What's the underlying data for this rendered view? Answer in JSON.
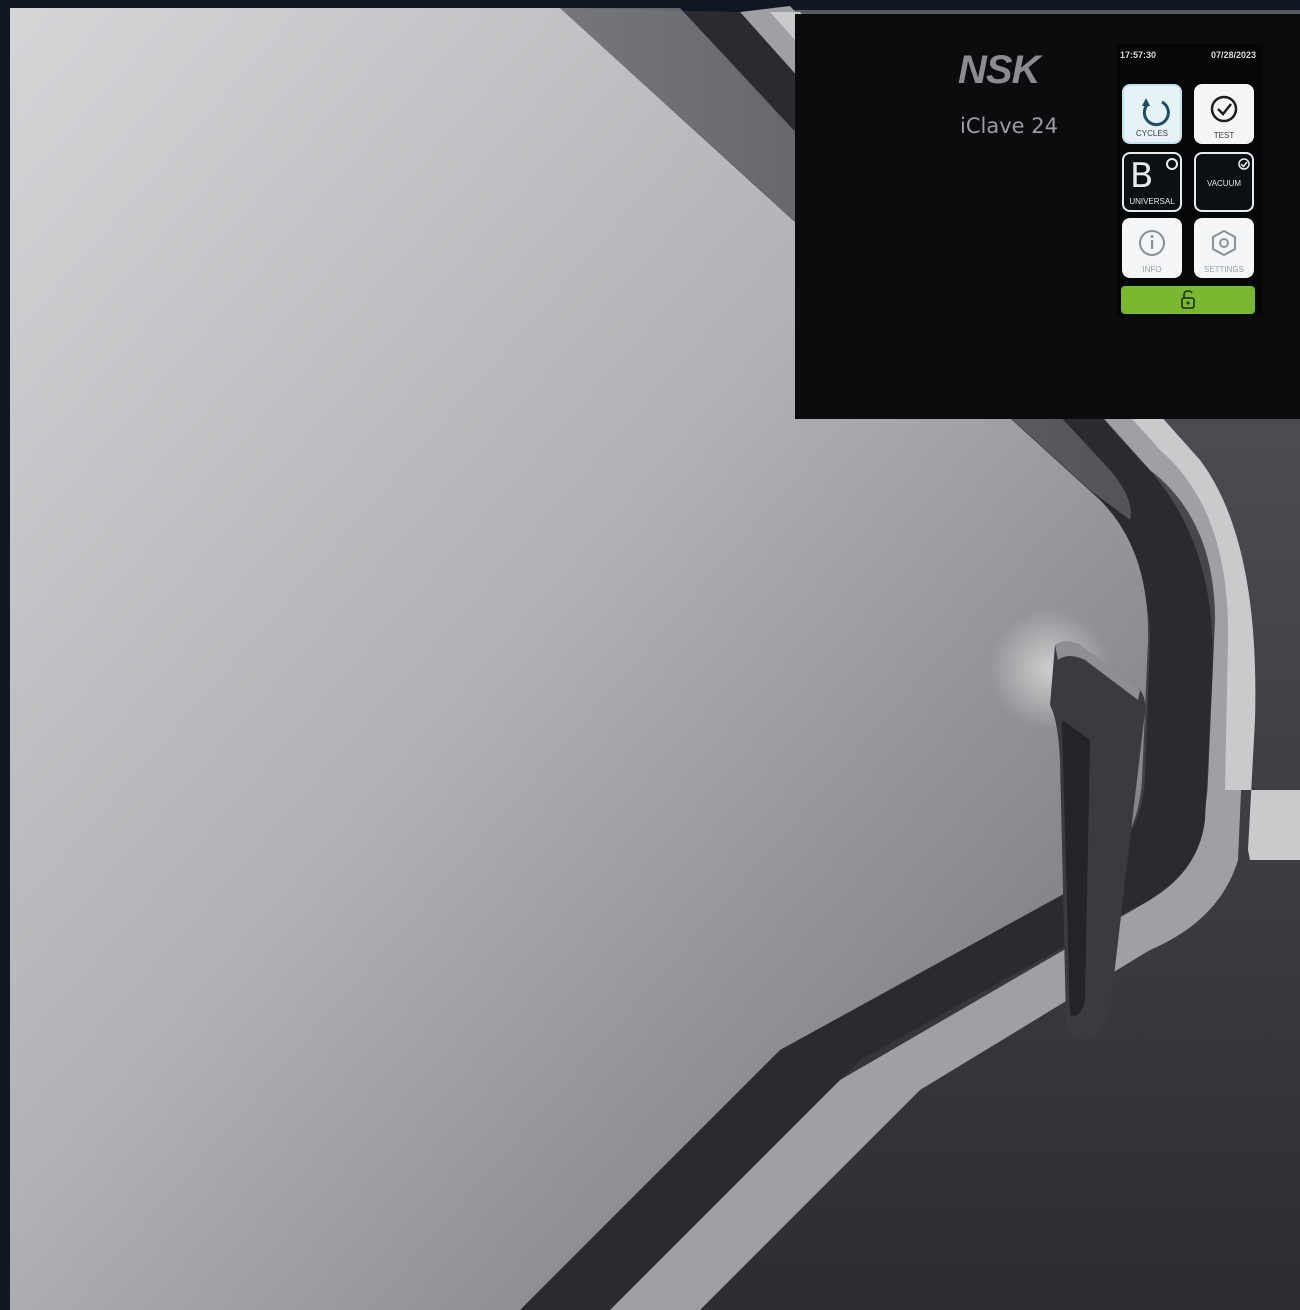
{
  "device": {
    "brand": "NSK",
    "model": "iClave 24"
  },
  "display": {
    "time": "17:57:30",
    "date": "07/28/2023",
    "tiles": [
      {
        "label": "CYCLES",
        "icon": "refresh-icon",
        "state": "selected"
      },
      {
        "label": "TEST",
        "icon": "check-circle-icon",
        "state": "normal"
      },
      {
        "label": "UNIVERSAL",
        "icon": "letter-b-icon",
        "letter": "B",
        "state": "dark"
      },
      {
        "label": "VACUUM",
        "icon": "vacuum-icon",
        "state": "dark"
      },
      {
        "label": "INFO",
        "icon": "info-icon",
        "state": "faded"
      },
      {
        "label": "SETTINGS",
        "icon": "gear-icon",
        "state": "faded"
      }
    ],
    "unlock_icon": "unlock-icon"
  },
  "colors": {
    "accent_green": "#7ab82e",
    "selected_tile": "#e6f2f5",
    "screen_bg": "#050607"
  }
}
